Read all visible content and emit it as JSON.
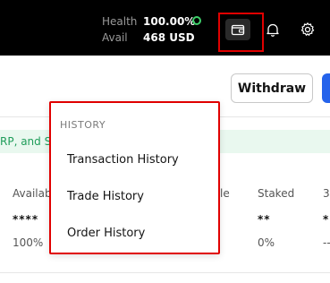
{
  "topbar": {
    "health_label": "Health",
    "health_value": "100.00%",
    "avail_label": "Avail",
    "avail_value": "468 USD",
    "colors": {
      "background": "#000000",
      "health_ok": "#3ecf6a",
      "highlight": "#e00000"
    }
  },
  "actions": {
    "withdraw_label": "Withdraw",
    "accent_color": "#2563eb"
  },
  "banner": {
    "text": "RP, and S"
  },
  "table": {
    "headers": [
      "Availab",
      "le",
      "Staked",
      "3"
    ],
    "row_values": [
      "****",
      "**",
      "*"
    ],
    "row_subvalues": [
      "100%",
      "0%",
      "--"
    ]
  },
  "menu": {
    "section_label": "HISTORY",
    "items": [
      "Transaction History",
      "Trade History",
      "Order History"
    ]
  }
}
